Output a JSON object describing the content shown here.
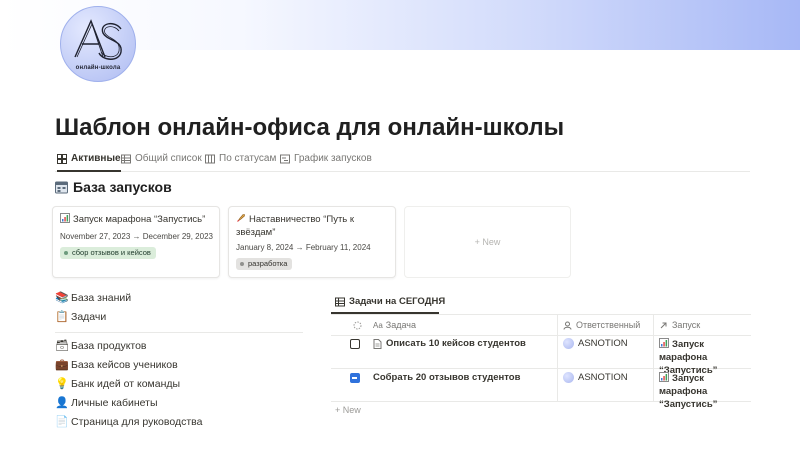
{
  "logo": {
    "caption": "онлайн-школа",
    "mark": "AS"
  },
  "page": {
    "title": "Шаблон онлайн-офиса для онлайн-школы"
  },
  "tabs": [
    {
      "label": "Активные",
      "icon": "gallery-icon",
      "active": true
    },
    {
      "label": "Общий список",
      "icon": "table-icon",
      "active": false
    },
    {
      "label": "По статусам",
      "icon": "board-icon",
      "active": false
    },
    {
      "label": "График запусков",
      "icon": "timeline-icon",
      "active": false
    }
  ],
  "launches": {
    "heading": "База запусков",
    "cards": [
      {
        "title": "Запуск марафона “Запустись”",
        "date": "November 27, 2023 → December 29, 2023",
        "tag": "сбор отзывов и кейсов",
        "tag_color": "green"
      },
      {
        "title": "Наставничество “Путь к звёздам”",
        "date": "January 8, 2024 → February 11, 2024",
        "tag": "разработка",
        "tag_color": "gray"
      }
    ],
    "new_label": "+ New"
  },
  "links": {
    "group1": [
      {
        "label": "База знаний",
        "icon": "books-icon"
      },
      {
        "label": "Задачи",
        "icon": "checklist-icon"
      }
    ],
    "group2": [
      {
        "label": "База продуктов",
        "icon": "box-icon"
      },
      {
        "label": "База кейсов учеников",
        "icon": "briefcase-icon"
      },
      {
        "label": "Банк идей от команды",
        "icon": "lightbulb-icon"
      },
      {
        "label": "Личные кабинеты",
        "icon": "person-icon"
      },
      {
        "label": "Страница для руководства",
        "icon": "document-icon"
      }
    ]
  },
  "tasks_table": {
    "title": "Задачи на СЕГОДНЯ",
    "columns": [
      {
        "label": "",
        "icon": "status-icon"
      },
      {
        "label": "Задача",
        "icon": "text-prop-icon"
      },
      {
        "label": "Ответственный",
        "icon": "person-prop-icon"
      },
      {
        "label": "Запуск",
        "icon": "relation-arrow-icon"
      }
    ],
    "rows": [
      {
        "done": false,
        "task": "Описать 10 кейсов студентов",
        "has_doc_icon": true,
        "owner": "ASNOTION",
        "launch": "Запуск марафона “Запустись”"
      },
      {
        "done": true,
        "task": "Собрать 20 отзывов студентов",
        "has_doc_icon": false,
        "owner": "ASNOTION",
        "launch": "Запуск марафона “Запустись”"
      }
    ],
    "new_label": "+ New"
  }
}
